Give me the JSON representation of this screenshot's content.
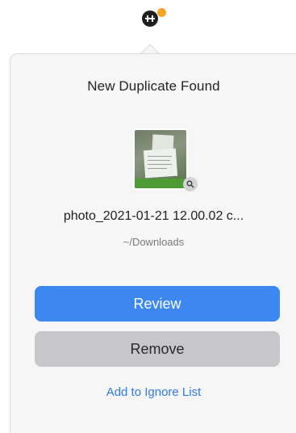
{
  "menubar": {
    "app_icon": "duplicate-finder-app-icon",
    "badge_color": "#f5a524"
  },
  "popover": {
    "title": "New Duplicate Found",
    "file": {
      "thumbnail_icon": "photo-thumbnail",
      "zoom_icon": "magnifier-icon",
      "name": "photo_2021-01-21 12.00.02 c...",
      "location": "~/Downloads"
    },
    "actions": {
      "review_label": "Review",
      "remove_label": "Remove",
      "ignore_label": "Add to Ignore List"
    }
  },
  "colors": {
    "primary": "#3d88f0",
    "secondary": "#c7c6cb",
    "link": "#2f7ae5"
  }
}
